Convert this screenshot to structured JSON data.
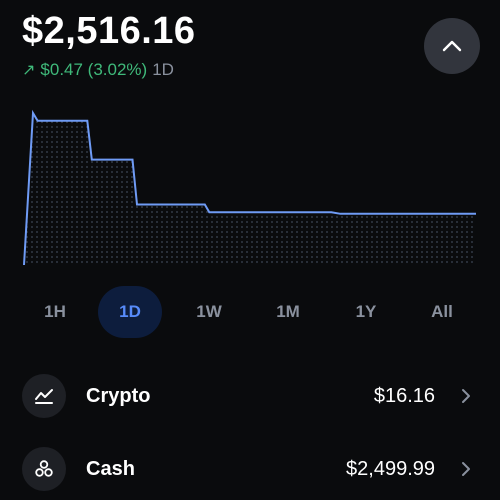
{
  "portfolio": {
    "balance": "$2,516.16",
    "change_arrow": "↗",
    "change_value": "$0.47 (3.02%)",
    "change_period": "1D"
  },
  "header": {
    "collapse_icon": "chevron-up-icon"
  },
  "chart_data": {
    "type": "area",
    "note_style": "step line with dotted fill",
    "x": [
      0,
      0.02,
      0.03,
      0.14,
      0.15,
      0.24,
      0.25,
      0.4,
      0.41,
      0.52,
      0.53,
      0.68,
      0.7,
      1.0
    ],
    "values": [
      0,
      0.98,
      0.93,
      0.93,
      0.68,
      0.68,
      0.39,
      0.39,
      0.34,
      0.34,
      0.34,
      0.34,
      0.33,
      0.33
    ],
    "ylim": [
      0,
      1
    ],
    "line_color": "#6f9bf5",
    "fill_dot_color": "#3d4656"
  },
  "timeframes": {
    "items": [
      "1H",
      "1D",
      "1W",
      "1M",
      "1Y",
      "All"
    ],
    "active": "1D",
    "active_bg": "#0d1d3d",
    "active_color": "#578bfa"
  },
  "assets": [
    {
      "label": "Crypto",
      "value": "$16.16",
      "icon": "chart-line-icon"
    },
    {
      "label": "Cash",
      "value": "$2,499.99",
      "icon": "coins-icon"
    }
  ],
  "colors": {
    "background": "#0a0b0d",
    "positive": "#3fb97a",
    "muted": "#8a919e"
  }
}
